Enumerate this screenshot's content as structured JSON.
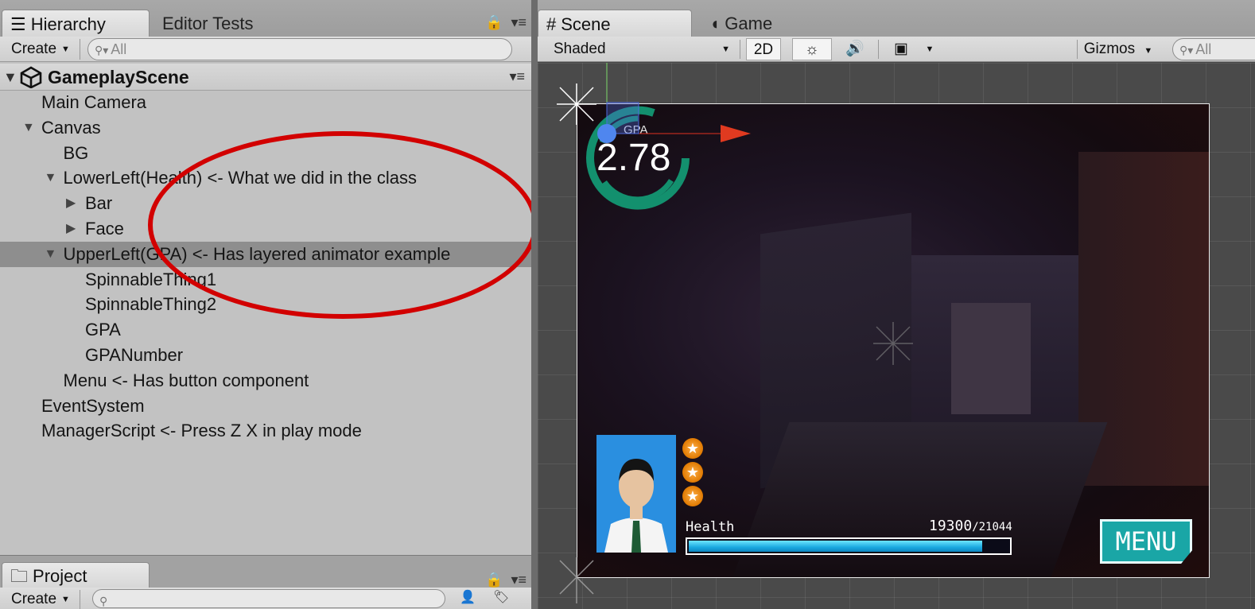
{
  "hierarchy": {
    "tab_label": "Hierarchy",
    "tab2_label": "Editor Tests",
    "create_label": "Create",
    "search_placeholder": "All",
    "scene_name": "GameplayScene",
    "rows": [
      {
        "label": "Main Camera",
        "depth": 0,
        "foldout": "none"
      },
      {
        "label": "Canvas",
        "depth": 0,
        "foldout": "open"
      },
      {
        "label": "BG",
        "depth": 1,
        "foldout": "none"
      },
      {
        "label": "LowerLeft(Health) <- What we did in the class",
        "depth": 1,
        "foldout": "open"
      },
      {
        "label": "Bar",
        "depth": 2,
        "foldout": "closed"
      },
      {
        "label": "Face",
        "depth": 2,
        "foldout": "closed"
      },
      {
        "label": "UpperLeft(GPA) <- Has layered animator example",
        "depth": 1,
        "foldout": "open",
        "selected": true
      },
      {
        "label": "SpinnableThing1",
        "depth": 2,
        "foldout": "none"
      },
      {
        "label": "SpinnableThing2",
        "depth": 2,
        "foldout": "none"
      },
      {
        "label": "GPA",
        "depth": 2,
        "foldout": "none"
      },
      {
        "label": "GPANumber",
        "depth": 2,
        "foldout": "none"
      },
      {
        "label": "Menu <- Has button component",
        "depth": 1,
        "foldout": "none"
      },
      {
        "label": "EventSystem",
        "depth": 0,
        "foldout": "none"
      },
      {
        "label": "ManagerScript <- Press Z X in play mode",
        "depth": 0,
        "foldout": "none"
      }
    ],
    "annotation_color": "#d20000"
  },
  "project": {
    "tab_label": "Project",
    "create_label": "Create"
  },
  "scene": {
    "tab_label": "Scene",
    "tab2_label": "Game",
    "shading_mode": "Shaded",
    "mode_2d": "2D",
    "gizmos_label": "Gizmos",
    "search_placeholder": "All"
  },
  "game_ui": {
    "gpa_label": "GPA",
    "gpa_value": "2.78",
    "health_label": "Health",
    "health_current": "19300",
    "health_max": "/21044",
    "health_fraction": 0.917,
    "stars": 3,
    "menu_label": "MENU",
    "accent_teal": "#1aa6a6",
    "ring_color": "#13906e"
  }
}
